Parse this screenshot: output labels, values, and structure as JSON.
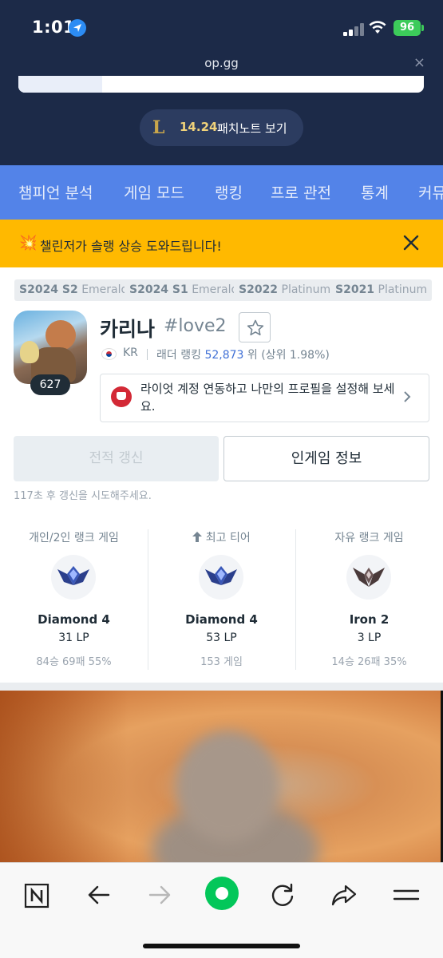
{
  "status_bar": {
    "time": "1:01",
    "battery": "96"
  },
  "browser": {
    "url": "op.gg",
    "close_glyph": "×"
  },
  "patch": {
    "version": "14.24",
    "label": "패치노트 보기"
  },
  "nav": {
    "items": [
      "챔피언 분석",
      "게임 모드",
      "랭킹",
      "프로 관전",
      "통계",
      "커뮤"
    ]
  },
  "banner": {
    "icon": "💥",
    "text": "챌린저가 솔랭 상승 도와드립니다!"
  },
  "seasons": [
    {
      "season": "S2024 S2",
      "tier": "Emerald"
    },
    {
      "season": "S2024 S1",
      "tier": "Emerald"
    },
    {
      "season": "S2022",
      "tier": "Platinum"
    },
    {
      "season": "S2021",
      "tier": "Platinum"
    }
  ],
  "profile": {
    "level": "627",
    "name": "카리나",
    "tag": "#love2",
    "region": "KR",
    "ladder_label": "래더 랭킹",
    "ladder_rank": "52,873",
    "ladder_suffix": "위 (상위 1.98%)"
  },
  "riot_link": {
    "text": "라이엇 계정 연동하고 나만의 프로필을 설정해 보세요."
  },
  "buttons": {
    "update": "전적 갱신",
    "ingame": "인게임 정보"
  },
  "retry_text": "117초 후 갱신을 시도해주세요.",
  "ranks": [
    {
      "label": "개인/2인 랭크 게임",
      "tier": "Diamond 4",
      "lp": "31 LP",
      "record": "84승 69패 55%",
      "emblem": "diamond-emblem"
    },
    {
      "label": "최고 티어",
      "tier": "Diamond 4",
      "lp": "53 LP",
      "record": "153 게임",
      "emblem": "diamond-emblem"
    },
    {
      "label": "자유 랭크 게임",
      "tier": "Iron 2",
      "lp": "3 LP",
      "record": "14승 26패 35%",
      "emblem": "iron-emblem"
    }
  ],
  "colors": {
    "header": "#1c2a48",
    "nav": "#5383e8",
    "banner": "#ffb900",
    "link": "#4171d6",
    "brand_green": "#03c75a"
  },
  "toolbar_icons": [
    "naver-icon",
    "back-arrow-icon",
    "forward-arrow-icon",
    "home-dot-icon",
    "refresh-icon",
    "share-icon",
    "menu-icon"
  ]
}
